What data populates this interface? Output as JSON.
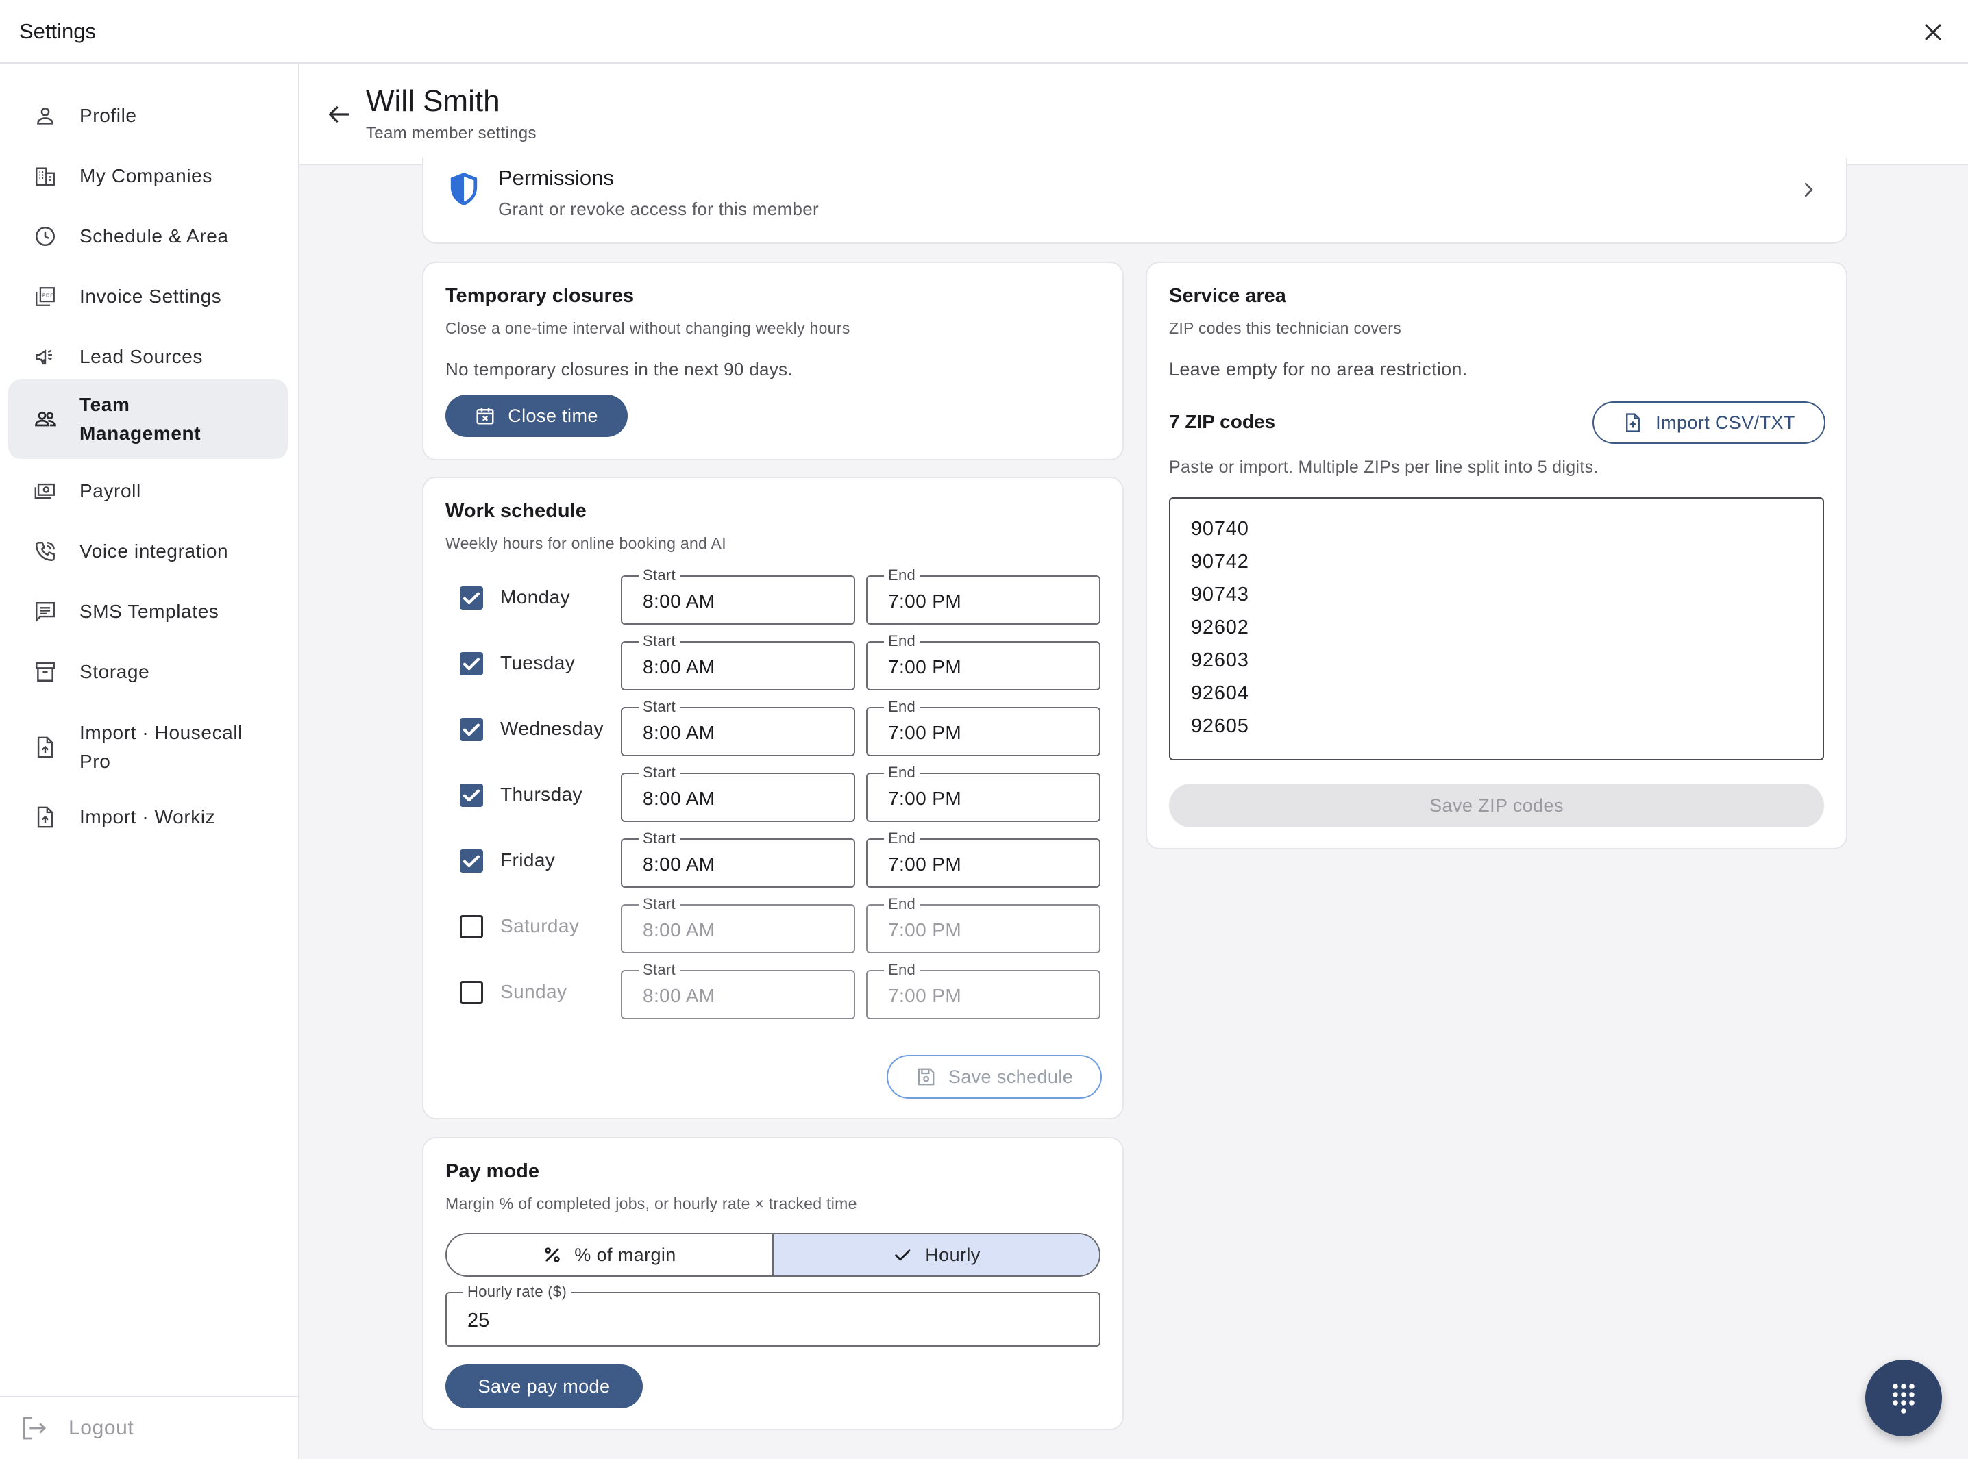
{
  "app": {
    "title": "Settings"
  },
  "colors": {
    "accent": "#3e5a86",
    "accent_light": "#d9e2f6",
    "fab": "#2f4468"
  },
  "sidebar": {
    "items": [
      {
        "label": "Profile",
        "icon": "person-icon",
        "active": false
      },
      {
        "label": "My Companies",
        "icon": "building-icon",
        "active": false
      },
      {
        "label": "Schedule & Area",
        "icon": "clock-icon",
        "active": false
      },
      {
        "label": "Invoice Settings",
        "icon": "pdf-icon",
        "active": false
      },
      {
        "label": "Lead Sources",
        "icon": "megaphone-icon",
        "active": false
      },
      {
        "label": "Team",
        "label2": "Management",
        "icon": "people-icon",
        "active": true
      },
      {
        "label": "Payroll",
        "icon": "cash-icon",
        "active": false
      },
      {
        "label": "Voice integration",
        "icon": "phone-icon",
        "active": false
      },
      {
        "label": "SMS Templates",
        "icon": "message-icon",
        "active": false
      },
      {
        "label": "Storage",
        "icon": "archive-icon",
        "active": false
      },
      {
        "label": "Import · Housecall",
        "label2": "Pro",
        "icon": "file-upload-icon",
        "active": false
      },
      {
        "label": "Import · Workiz",
        "icon": "file-upload-icon",
        "active": false
      }
    ],
    "logout": "Logout"
  },
  "header": {
    "title": "Will Smith",
    "subtitle": "Team member settings"
  },
  "permissions": {
    "title": "Permissions",
    "subtitle": "Grant or revoke access for this member"
  },
  "closures": {
    "title": "Temporary closures",
    "subtitle": "Close a one-time interval without changing weekly hours",
    "empty": "No temporary closures in the next 90 days.",
    "button": "Close time"
  },
  "schedule": {
    "title": "Work schedule",
    "subtitle": "Weekly hours for online booking and AI",
    "start_label": "Start",
    "end_label": "End",
    "days": [
      {
        "day": "Monday",
        "enabled": true,
        "start": "8:00 AM",
        "end": "7:00 PM"
      },
      {
        "day": "Tuesday",
        "enabled": true,
        "start": "8:00 AM",
        "end": "7:00 PM"
      },
      {
        "day": "Wednesday",
        "enabled": true,
        "start": "8:00 AM",
        "end": "7:00 PM"
      },
      {
        "day": "Thursday",
        "enabled": true,
        "start": "8:00 AM",
        "end": "7:00 PM"
      },
      {
        "day": "Friday",
        "enabled": true,
        "start": "8:00 AM",
        "end": "7:00 PM"
      },
      {
        "day": "Saturday",
        "enabled": false,
        "start": "8:00 AM",
        "end": "7:00 PM"
      },
      {
        "day": "Sunday",
        "enabled": false,
        "start": "8:00 AM",
        "end": "7:00 PM"
      }
    ],
    "save_button": "Save schedule"
  },
  "pay_mode": {
    "title": "Pay mode",
    "subtitle": "Margin % of completed jobs, or hourly rate × tracked time",
    "option_margin": "% of margin",
    "option_hourly": "Hourly",
    "selected": "Hourly",
    "rate_label": "Hourly rate ($)",
    "rate_value": "25",
    "save_button": "Save pay mode"
  },
  "service_area": {
    "title": "Service area",
    "subtitle": "ZIP codes this technician covers",
    "note": "Leave empty for no area restriction.",
    "count_label": "7 ZIP codes",
    "import_button": "Import CSV/TXT",
    "hint": "Paste or import. Multiple ZIPs per line split into 5 digits.",
    "zips": [
      "90740",
      "90742",
      "90743",
      "92602",
      "92603",
      "92604",
      "92605"
    ],
    "save_button": "Save ZIP codes"
  }
}
